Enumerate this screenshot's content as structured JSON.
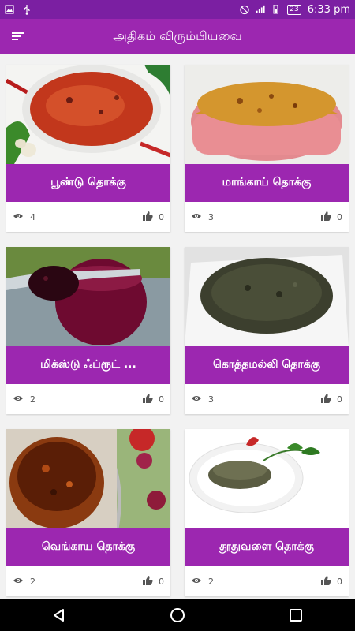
{
  "status": {
    "time": "6:33 pm",
    "battery": "23",
    "icons": [
      "image-icon",
      "usb-icon",
      "do-not-disturb-icon",
      "signal-icon",
      "battery-icon"
    ]
  },
  "app_bar": {
    "title": "அதிகம் விரும்பியவை",
    "menu_icon": "menu-icon"
  },
  "colors": {
    "primary": "#9c27b0",
    "primary_dark": "#7b1fa2"
  },
  "cards": [
    {
      "title": "பூண்டு தொக்கு",
      "views": "4",
      "likes": "0",
      "image": "red-garlic-chutney-bowl"
    },
    {
      "title": "மாங்காய் தொக்கு",
      "views": "3",
      "likes": "0",
      "image": "mango-thokku-pink-bowl"
    },
    {
      "title": "மிக்ஸ்டு ஃப்ரூட் ...",
      "views": "2",
      "likes": "0",
      "image": "mixed-fruit-jam-jar"
    },
    {
      "title": "கொத்தமல்லி தொக்கு",
      "views": "3",
      "likes": "0",
      "image": "coriander-thokku-white-dish"
    },
    {
      "title": "வெங்காய தொக்கு",
      "views": "2",
      "likes": "0",
      "image": "onion-thokku-jar"
    },
    {
      "title": "தூதுவளை தொக்கு",
      "views": "2",
      "likes": "0",
      "image": "thuthuvalai-thokku-plate"
    }
  ],
  "nav": [
    "back-icon",
    "home-icon",
    "recents-icon"
  ]
}
